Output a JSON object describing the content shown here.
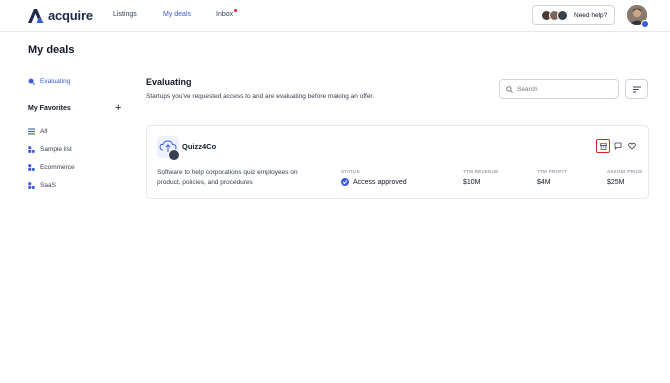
{
  "header": {
    "brand": "acquire",
    "nav": [
      {
        "label": "Listings",
        "active": false
      },
      {
        "label": "My deals",
        "active": true
      },
      {
        "label": "Inbox",
        "active": false,
        "notification_dot": true
      }
    ],
    "help_label": "Need help?",
    "accent_color": "#3b5bdb"
  },
  "page": {
    "title": "My deals"
  },
  "sidebar": {
    "evaluating_label": "Evaluating",
    "favorites_heading": "My Favorites",
    "favorites_add_symbol": "+",
    "lists": [
      "All",
      "Sample list",
      "Ecommerce",
      "SaaS"
    ]
  },
  "main": {
    "title": "Evaluating",
    "subtitle": "Startups you've requested access to and are evaluating before making an offer.",
    "search_placeholder": "Search"
  },
  "deal": {
    "name": "Quizz4Co",
    "description": "Software to help corporations quiz employees on product, policies, and procedures",
    "status_label": "STATUS",
    "status_value": "Access approved",
    "revenue_label": "TTM REVENUE",
    "revenue_value": "$10M",
    "profit_label": "TTM PROFIT",
    "profit_value": "$4M",
    "price_label": "ASKING PRICE",
    "price_value": "$25M",
    "actions": [
      "archive-icon",
      "chat-icon",
      "heart-icon"
    ]
  }
}
